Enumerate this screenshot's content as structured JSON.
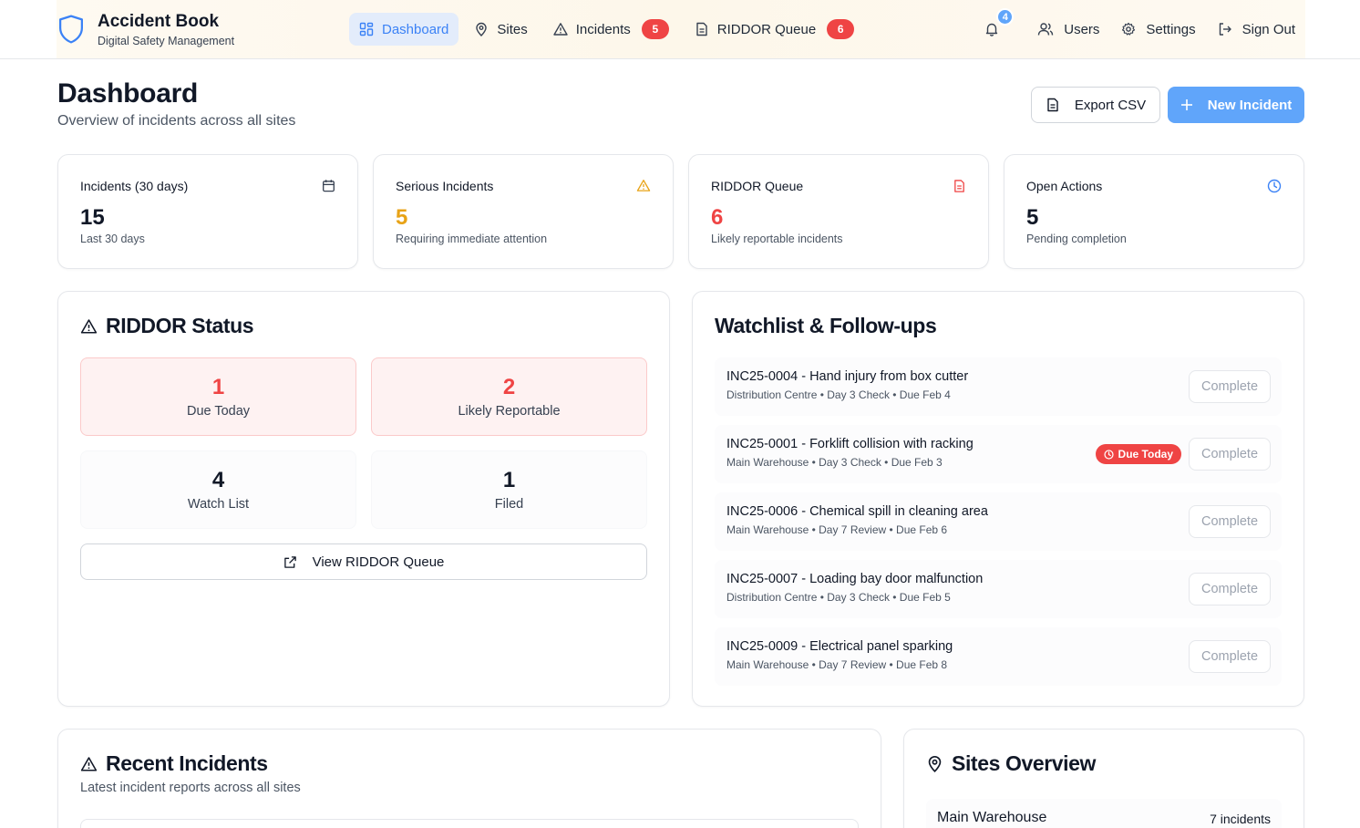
{
  "app": {
    "title": "Accident Book",
    "subtitle": "Digital Safety Management"
  },
  "nav": {
    "items": [
      {
        "label": "Dashboard",
        "icon": "dashboard-icon",
        "active": true
      },
      {
        "label": "Sites",
        "icon": "map-pin-icon"
      },
      {
        "label": "Incidents",
        "icon": "warning-icon",
        "badge": "5"
      },
      {
        "label": "RIDDOR Queue",
        "icon": "document-icon",
        "badge": "6"
      }
    ],
    "notifications_count": "4",
    "users_label": "Users",
    "settings_label": "Settings",
    "signout_label": "Sign Out"
  },
  "page": {
    "title": "Dashboard",
    "subtitle": "Overview of incidents across all sites",
    "export_label": "Export CSV",
    "new_label": "New Incident"
  },
  "stats": [
    {
      "label": "Incidents (30 days)",
      "value": "15",
      "desc": "Last 30 days",
      "icon": "calendar-icon",
      "color": "#111827"
    },
    {
      "label": "Serious Incidents",
      "value": "5",
      "desc": "Requiring immediate attention",
      "icon": "warning-icon",
      "color": "#e8a317"
    },
    {
      "label": "RIDDOR Queue",
      "value": "6",
      "desc": "Likely reportable incidents",
      "icon": "document-icon",
      "color": "#ef4444"
    },
    {
      "label": "Open Actions",
      "value": "5",
      "desc": "Pending completion",
      "icon": "clock-icon",
      "color": "#111827"
    }
  ],
  "riddor": {
    "title": "RIDDOR Status",
    "tiles": [
      {
        "value": "1",
        "label": "Due Today"
      },
      {
        "value": "2",
        "label": "Likely Reportable"
      },
      {
        "value": "4",
        "label": "Watch List"
      },
      {
        "value": "1",
        "label": "Filed"
      }
    ],
    "view_label": "View RIDDOR Queue"
  },
  "watchlist": {
    "title": "Watchlist & Follow-ups",
    "complete_label": "Complete",
    "due_today_label": "Due Today",
    "items": [
      {
        "title": "INC25-0004 - Hand injury from box cutter",
        "sub": "Distribution Centre • Day 3 Check • Due Feb 4"
      },
      {
        "title": "INC25-0001 - Forklift collision with racking",
        "sub": "Main Warehouse • Day 3 Check • Due Feb 3"
      },
      {
        "title": "INC25-0006 - Chemical spill in cleaning area",
        "sub": "Main Warehouse • Day 7 Review • Due Feb 6"
      },
      {
        "title": "INC25-0007 - Loading bay door malfunction",
        "sub": "Distribution Centre • Day 3 Check • Due Feb 5"
      },
      {
        "title": "INC25-0009 - Electrical panel sparking",
        "sub": "Main Warehouse • Day 7 Review • Due Feb 8"
      }
    ]
  },
  "recent": {
    "title": "Recent Incidents",
    "subtitle": "Latest incident reports across all sites"
  },
  "sites": {
    "title": "Sites Overview",
    "rows": [
      {
        "name": "Main Warehouse",
        "count": "7 incidents"
      }
    ]
  },
  "colors": {
    "accent": "#60a5fa",
    "danger": "#ef4444",
    "warning": "#e8a317"
  }
}
